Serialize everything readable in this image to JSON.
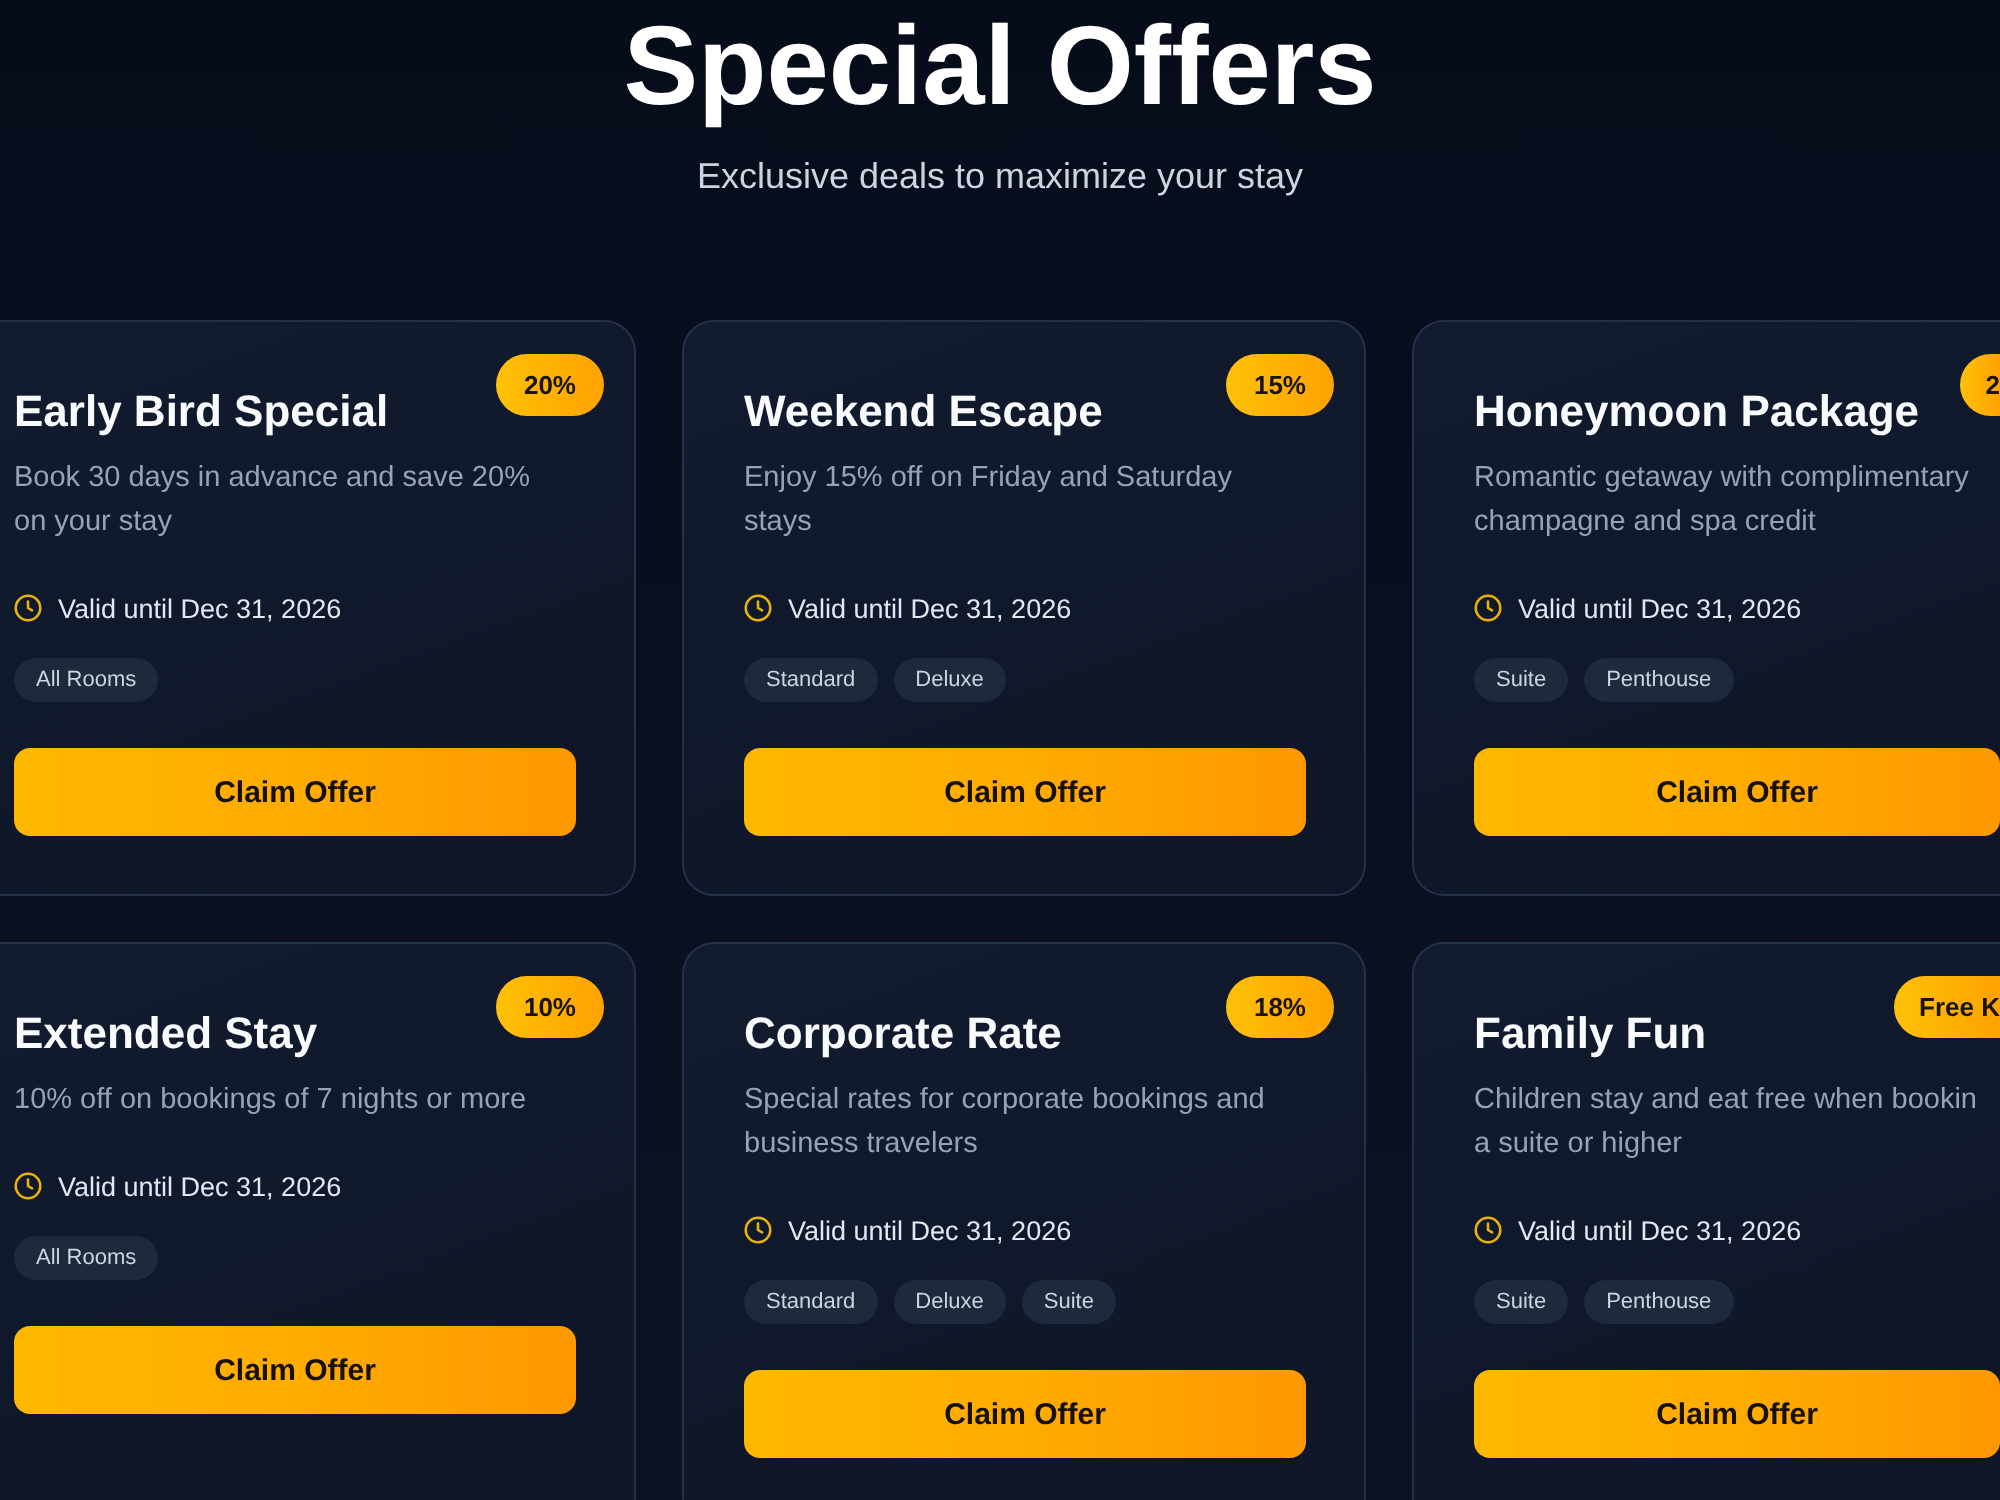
{
  "header": {
    "title": "Special Offers",
    "subtitle": "Exclusive deals to maximize your stay"
  },
  "offers": [
    {
      "title": "Early Bird Special",
      "badge": "20%",
      "description_lines": [
        "Book 30 days in advance and save 20%",
        "on your stay"
      ],
      "validity": "Valid until Dec 31, 2026",
      "room_tags": [
        "All Rooms"
      ],
      "button": "Claim Offer"
    },
    {
      "title": "Weekend Escape",
      "badge": "15%",
      "description_lines": [
        "Enjoy 15% off on Friday and Saturday",
        "stays"
      ],
      "validity": "Valid until Dec 31, 2026",
      "room_tags": [
        "Standard",
        "Deluxe"
      ],
      "button": "Claim Offer"
    },
    {
      "title": "Honeymoon Package",
      "badge": "2",
      "description_lines": [
        "Romantic getaway with complimentary",
        "champagne and spa credit"
      ],
      "validity": "Valid until Dec 31, 2026",
      "room_tags": [
        "Suite",
        "Penthouse"
      ],
      "button": "Claim Offer"
    },
    {
      "title": "Extended Stay",
      "badge": "10%",
      "description_lines": [
        "10% off on bookings of 7 nights or more"
      ],
      "validity": "Valid until Dec 31, 2026",
      "room_tags": [
        "All Rooms"
      ],
      "button": "Claim Offer"
    },
    {
      "title": "Corporate Rate",
      "badge": "18%",
      "description_lines": [
        "Special rates for corporate bookings and",
        "business travelers"
      ],
      "validity": "Valid until Dec 31, 2026",
      "room_tags": [
        "Standard",
        "Deluxe",
        "Suite"
      ],
      "button": "Claim Offer"
    },
    {
      "title": "Family Fun",
      "badge": "Free K",
      "description_lines": [
        "Children stay and eat free when bookin",
        "a suite or higher"
      ],
      "validity": "Valid until Dec 31, 2026",
      "room_tags": [
        "Suite",
        "Penthouse"
      ],
      "button": "Claim Offer"
    }
  ]
}
